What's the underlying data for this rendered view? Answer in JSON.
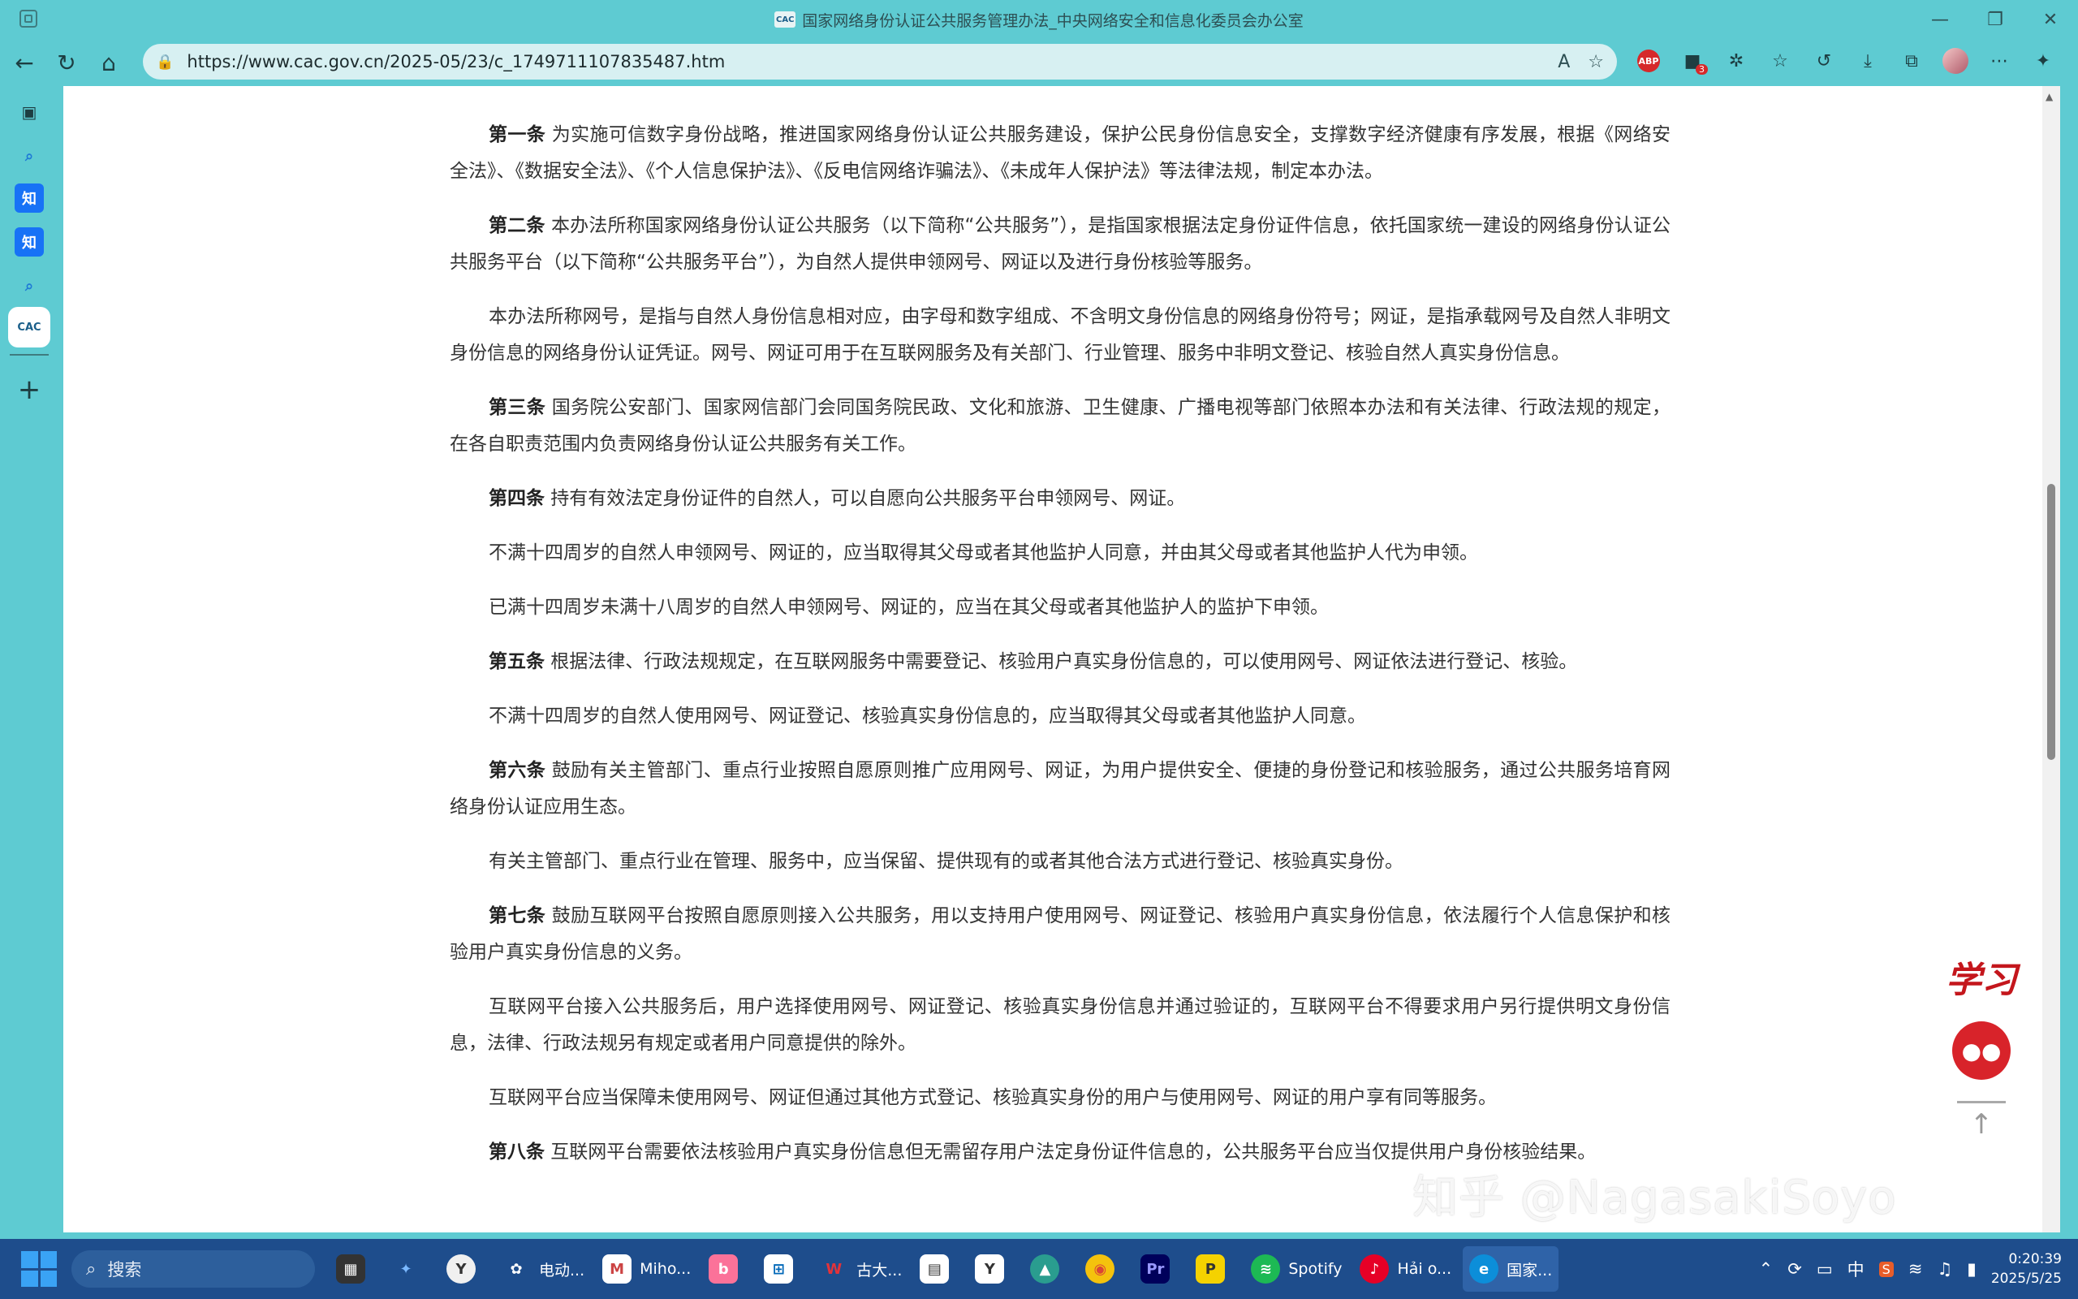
{
  "window": {
    "title": "国家网络身份认证公共服务管理办法_中央网络安全和信息化委员会办公室",
    "site_logo_text": "CAC",
    "minimize": "—",
    "maximize": "❐",
    "close": "✕"
  },
  "toolbar": {
    "url": "https://www.cac.gov.cn/2025-05/23/c_1749711107835487.htm",
    "abp_label": "ABP",
    "ext_badge": "3"
  },
  "sidebar": {
    "zhi_label": "知",
    "cac_label": "CAC",
    "add_label": "+"
  },
  "article": {
    "p1_head": "第一条",
    "p1_text": " 为实施可信数字身份战略，推进国家网络身份认证公共服务建设，保护公民身份信息安全，支撑数字经济健康有序发展，根据《网络安全法》、《数据安全法》、《个人信息保护法》、《反电信网络诈骗法》、《未成年人保护法》等法律法规，制定本办法。",
    "p2_head": "第二条",
    "p2_text": " 本办法所称国家网络身份认证公共服务（以下简称“公共服务”），是指国家根据法定身份证件信息，依托国家统一建设的网络身份认证公共服务平台（以下简称“公共服务平台”），为自然人提供申领网号、网证以及进行身份核验等服务。",
    "p3_text": "本办法所称网号，是指与自然人身份信息相对应，由字母和数字组成、不含明文身份信息的网络身份符号；网证，是指承载网号及自然人非明文身份信息的网络身份认证凭证。网号、网证可用于在互联网服务及有关部门、行业管理、服务中非明文登记、核验自然人真实身份信息。",
    "p4_head": "第三条",
    "p4_text": " 国务院公安部门、国家网信部门会同国务院民政、文化和旅游、卫生健康、广播电视等部门依照本办法和有关法律、行政法规的规定，在各自职责范围内负责网络身份认证公共服务有关工作。",
    "p5_head": "第四条",
    "p5_text": " 持有有效法定身份证件的自然人，可以自愿向公共服务平台申领网号、网证。",
    "p6_text": "不满十四周岁的自然人申领网号、网证的，应当取得其父母或者其他监护人同意，并由其父母或者其他监护人代为申领。",
    "p7_text": "已满十四周岁未满十八周岁的自然人申领网号、网证的，应当在其父母或者其他监护人的监护下申领。",
    "p8_head": "第五条",
    "p8_text": " 根据法律、行政法规规定，在互联网服务中需要登记、核验用户真实身份信息的，可以使用网号、网证依法进行登记、核验。",
    "p9_text": "不满十四周岁的自然人使用网号、网证登记、核验真实身份信息的，应当取得其父母或者其他监护人同意。",
    "p10_head": "第六条",
    "p10_text": " 鼓励有关主管部门、重点行业按照自愿原则推广应用网号、网证，为用户提供安全、便捷的身份登记和核验服务，通过公共服务培育网络身份认证应用生态。",
    "p11_text": "有关主管部门、重点行业在管理、服务中，应当保留、提供现有的或者其他合法方式进行登记、核验真实身份。",
    "p12_head": "第七条",
    "p12_text": " 鼓励互联网平台按照自愿原则接入公共服务，用以支持用户使用网号、网证登记、核验用户真实身份信息，依法履行个人信息保护和核验用户真实身份信息的义务。",
    "p13_text": "互联网平台接入公共服务后，用户选择使用网号、网证登记、核验真实身份信息并通过验证的，互联网平台不得要求用户另行提供明文身份信息，法律、行政法规另有规定或者用户同意提供的除外。",
    "p14_text": "互联网平台应当保障未使用网号、网证但通过其他方式登记、核验真实身份的用户与使用网号、网证的用户享有同等服务。",
    "p15_head": "第八条",
    "p15_text": " 互联网平台需要依法核验用户真实身份信息但无需留存用户法定身份证件信息的，公共服务平台应当仅提供用户身份核验结果。"
  },
  "float_panel": {
    "xuexi": "学习",
    "top_arrow": "↑"
  },
  "watermark": "知乎 @NagasakiSoyo",
  "taskbar": {
    "search_placeholder": "搜索",
    "app_chatgpt": "电动...",
    "app_mail": "Miho...",
    "app_wps": "古大...",
    "app_spotify": "Spotify",
    "app_netease": "Hải o...",
    "app_edge": "国家...",
    "ime": "中",
    "time": "0:20:39",
    "date": "2025/5/25"
  }
}
